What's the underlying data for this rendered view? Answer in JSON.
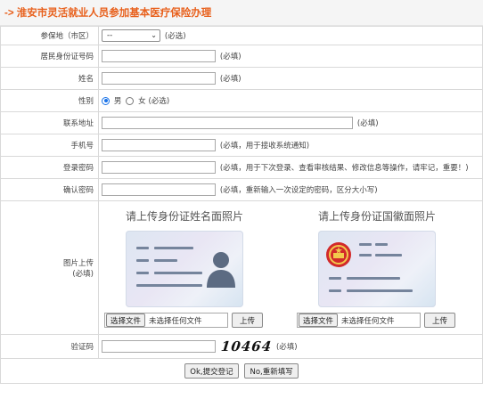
{
  "header": {
    "title": "-> 淮安市灵活就业人员参加基本医疗保险办理"
  },
  "form": {
    "district": {
      "label": "参保地（市区）",
      "value": "--",
      "note": "(必选)"
    },
    "id_number": {
      "label": "居民身份证号码",
      "value": "",
      "note": "(必填)"
    },
    "name": {
      "label": "姓名",
      "value": "",
      "note": "(必填)"
    },
    "gender": {
      "label": "性别",
      "male": "男",
      "female": "女",
      "note": "(必选)",
      "selected": "男"
    },
    "address": {
      "label": "联系地址",
      "value": "",
      "note": "(必填)"
    },
    "phone": {
      "label": "手机号",
      "value": "",
      "note": "(必填，用于接收系统通知)"
    },
    "password": {
      "label": "登录密码",
      "value": "",
      "note": "(必填，用于下次登录、查看审核结果、修改信息等操作，请牢记，重要！)"
    },
    "confirm_password": {
      "label": "确认密码",
      "value": "",
      "note": "(必填，重新输入一次设定的密码，区分大小写)"
    },
    "photo_upload": {
      "label": "图片上传",
      "note": "(必填)",
      "front": {
        "title": "请上传身份证姓名面照片",
        "choose": "选择文件",
        "status": "未选择任何文件",
        "upload": "上传"
      },
      "back": {
        "title": "请上传身份证国徽面照片",
        "choose": "选择文件",
        "status": "未选择任何文件",
        "upload": "上传"
      }
    },
    "captcha": {
      "label": "验证码",
      "value": "",
      "code": "10464",
      "note": "(必填)"
    }
  },
  "actions": {
    "submit": "Ok,提交登记",
    "reset": "No,重新填写"
  },
  "colors": {
    "title": "#e8601c",
    "radio_accent": "#1a73e8",
    "emblem_red": "#d22a2a",
    "emblem_gold": "#f2c94c"
  },
  "icons": [
    "person-silhouette-icon",
    "national-emblem-icon",
    "chevron-down-icon"
  ]
}
